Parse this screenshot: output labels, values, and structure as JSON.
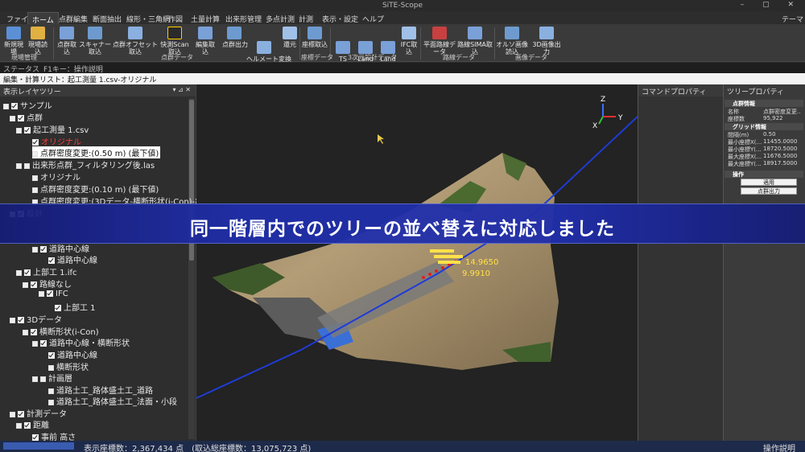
{
  "window": {
    "title": "SiTE-Scope",
    "controls": "– ▢ ✕"
  },
  "menu": {
    "tabs": [
      {
        "label": "ファイル",
        "active": false
      },
      {
        "label": "ホーム",
        "active": true
      },
      {
        "label": "点群編集",
        "active": false
      },
      {
        "label": "断面抽出",
        "active": false
      },
      {
        "label": "線形・三角網",
        "active": false
      },
      {
        "label": "作図",
        "active": false
      },
      {
        "label": "土量計算",
        "active": false
      },
      {
        "label": "出来形管理",
        "active": false
      },
      {
        "label": "多点計測",
        "active": false
      },
      {
        "label": "計測",
        "active": false
      },
      {
        "label": "表示・設定",
        "active": false
      },
      {
        "label": "ヘルプ",
        "active": false
      }
    ],
    "theme_label": "テーマ"
  },
  "ribbon": {
    "buttons": [
      {
        "label": "新規現場",
        "icon": "new-site-icon"
      },
      {
        "label": "現場読込",
        "icon": "open-folder-icon"
      },
      {
        "label": "点群取込",
        "icon": "point-cloud-import-icon"
      },
      {
        "label": "スキャナー取込",
        "icon": "scanner-icon"
      },
      {
        "label": "点群オフセット取込",
        "icon": "offset-import-icon"
      },
      {
        "label": "快測Scan取込",
        "icon": "scan-import-icon"
      },
      {
        "label": "編集取込",
        "icon": "edit-import-icon"
      },
      {
        "label": "点群出力",
        "icon": "export-icon"
      },
      {
        "label": "ヘルメート変換\n点群出力",
        "icon": "helmert-icon"
      },
      {
        "label": "還元",
        "icon": "restore-icon"
      },
      {
        "label": "座標取込",
        "icon": "coordinate-import-icon"
      },
      {
        "label": "TS\nXML取込",
        "icon": "ts-xml-icon"
      },
      {
        "label": "Land\nXML取込",
        "icon": "landxml-icon"
      },
      {
        "label": "Land\nXML出力",
        "icon": "landxml-export-icon"
      },
      {
        "label": "IFC取込",
        "icon": "ifc-icon"
      },
      {
        "label": "平面路線データ",
        "icon": "route-plan-icon"
      },
      {
        "label": "路線SIMA取込",
        "icon": "sima-icon"
      },
      {
        "label": "オルソ画像読込",
        "icon": "ortho-image-icon"
      },
      {
        "label": "3D画像出力",
        "icon": "3d-image-icon"
      }
    ],
    "groups": [
      "現場管理",
      "点群データ",
      "座標データ",
      "3次元設計データ",
      "路線データ",
      "画像データ"
    ]
  },
  "status_row": {
    "label": "ステータス",
    "text": "F1キー：操作説明"
  },
  "edit_row": {
    "label": "編集・計算リスト：",
    "value": "起工測量 1.csv-オリジナル"
  },
  "tree_panel": {
    "title": "表示レイヤツリー",
    "pin": "▾ ⊿ ✕",
    "items": [
      {
        "label": "サンプル"
      },
      {
        "label": "点群"
      },
      {
        "label": "起工測量 1.csv"
      },
      {
        "label": "オリジナル"
      },
      {
        "label": "点群密度変更:(0.50 m) (最下値)"
      },
      {
        "label": "出来形点群_フィルタリング後.las"
      },
      {
        "label": "オリジナル"
      },
      {
        "label": "点群密度変更:(0.10 m) (最下値)"
      },
      {
        "label": "点群密度変更:(3Dデータ-横断形状(i-Con)-計"
      },
      {
        "label": "設計"
      },
      {
        "label": "道路中心線"
      },
      {
        "label": "道路中心線"
      },
      {
        "label": "上部工 1.ifc"
      },
      {
        "label": "路線なし"
      },
      {
        "label": "IFC"
      },
      {
        "label": "上部工 1"
      },
      {
        "label": "3Dデータ"
      },
      {
        "label": "横断形状(i-Con)"
      },
      {
        "label": "道路中心線・横断形状"
      },
      {
        "label": "道路中心線"
      },
      {
        "label": "横断形状"
      },
      {
        "label": "計画層"
      },
      {
        "label": "道路土工_路体盛土工_道路"
      },
      {
        "label": "道路土工_路体盛土工_法面・小段"
      },
      {
        "label": "計測データ"
      },
      {
        "label": "距離"
      },
      {
        "label": "事前 高さ"
      }
    ]
  },
  "viewport": {
    "annotations": [
      "14.9650",
      "9.9910"
    ],
    "axes": {
      "z": "Z",
      "y": "Y",
      "x": "X"
    }
  },
  "command_panel": {
    "title": "コマンドプロパティ"
  },
  "property_panel": {
    "title": "ツリープロパティ",
    "sections": {
      "point_info": "点群情報",
      "grid_info": "グリッド情報",
      "operation": "操作"
    },
    "rows_point": [
      {
        "key": "名称",
        "value": "点群密度変更..."
      },
      {
        "key": "座標数",
        "value": "95,922"
      }
    ],
    "rows_grid": [
      {
        "key": "間隔(m)",
        "value": "0.50"
      },
      {
        "key": "最小座標X(...",
        "value": "11455.0000"
      },
      {
        "key": "最小座標Y(...",
        "value": "18720.5000"
      },
      {
        "key": "最大座標X(...",
        "value": "11676.5000"
      },
      {
        "key": "最大座標Y(...",
        "value": "18917.5000"
      }
    ],
    "buttons": {
      "apply": "適用",
      "export": "点群出力"
    }
  },
  "bottom_bar": {
    "display_count": "表示座標数：2,367,434 点　(取込総座標数：13,075,723 点)",
    "help": "操作説明"
  },
  "banner": {
    "text": "同一階層内でのツリーの並べ替えに対応しました"
  },
  "colors": {
    "banner": "#2434a8",
    "accent_red": "#ff3b3b",
    "route_line": "#1f3bd6"
  }
}
